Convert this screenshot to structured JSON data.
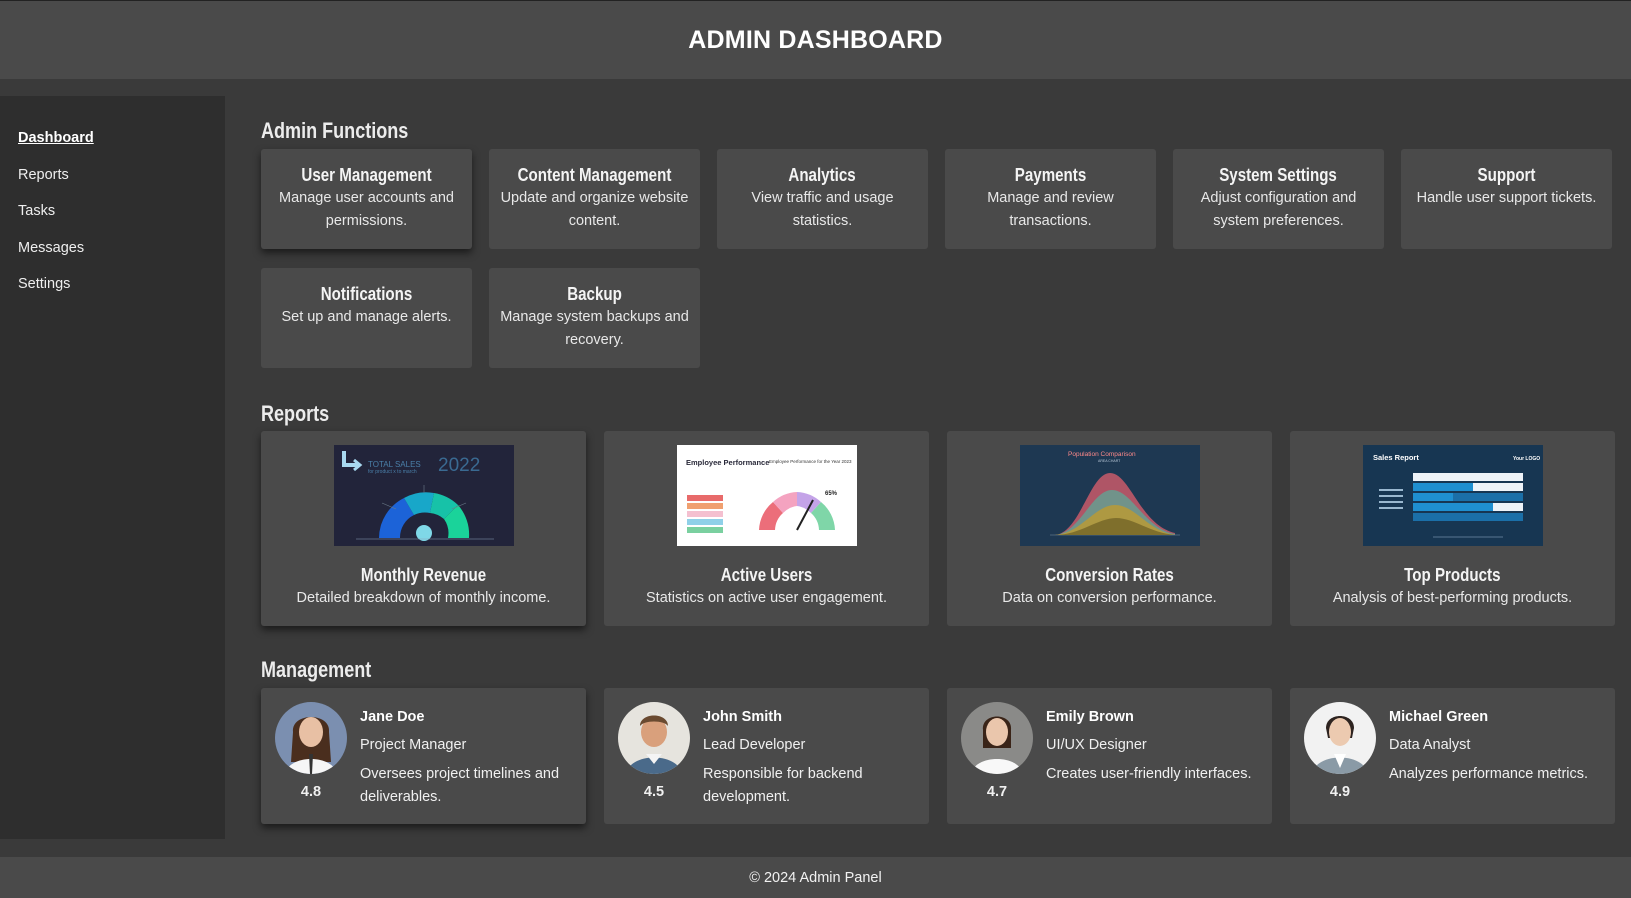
{
  "header": {
    "title": "ADMIN DASHBOARD"
  },
  "sidebar": {
    "items": [
      {
        "label": "Dashboard",
        "active": true
      },
      {
        "label": "Reports"
      },
      {
        "label": "Tasks"
      },
      {
        "label": "Messages"
      },
      {
        "label": "Settings"
      }
    ]
  },
  "admin_functions": {
    "title": "Admin Functions",
    "cards": [
      {
        "title": "User Management",
        "desc": "Manage user accounts and permissions."
      },
      {
        "title": "Content Management",
        "desc": "Update and organize website content."
      },
      {
        "title": "Analytics",
        "desc": "View traffic and usage statistics."
      },
      {
        "title": "Payments",
        "desc": "Manage and review transactions."
      },
      {
        "title": "System Settings",
        "desc": "Adjust configuration and system preferences."
      },
      {
        "title": "Support",
        "desc": "Handle user support tickets."
      },
      {
        "title": "Notifications",
        "desc": "Set up and manage alerts."
      },
      {
        "title": "Backup",
        "desc": "Manage system backups and recovery."
      }
    ]
  },
  "reports": {
    "title": "Reports",
    "cards": [
      {
        "title": "Monthly Revenue",
        "desc": "Detailed breakdown of monthly income.",
        "thumb": {
          "heading": "TOTAL SALES",
          "subheading": "for product x to march",
          "year": "2022"
        }
      },
      {
        "title": "Active Users",
        "desc": "Statistics on active user engagement.",
        "thumb": {
          "heading": "Employee Performance",
          "subheading": "Employee Performance for the Year 2023",
          "percent": "65%"
        }
      },
      {
        "title": "Conversion Rates",
        "desc": "Data on conversion performance.",
        "thumb": {
          "heading": "Population Comparison",
          "subheading": "AREA CHART"
        }
      },
      {
        "title": "Top Products",
        "desc": "Analysis of best-performing products.",
        "thumb": {
          "heading": "Sales Report",
          "logo": "Your LOGO"
        }
      }
    ]
  },
  "management": {
    "title": "Management",
    "people": [
      {
        "name": "Jane Doe",
        "role": "Project Manager",
        "desc": "Oversees project timelines and deliverables.",
        "rating": "4.8"
      },
      {
        "name": "John Smith",
        "role": "Lead Developer",
        "desc": "Responsible for backend development.",
        "rating": "4.5"
      },
      {
        "name": "Emily Brown",
        "role": "UI/UX Designer",
        "desc": "Creates user-friendly interfaces.",
        "rating": "4.7"
      },
      {
        "name": "Michael Green",
        "role": "Data Analyst",
        "desc": "Analyzes performance metrics.",
        "rating": "4.9"
      }
    ]
  },
  "footer": {
    "text": "© 2024 Admin Panel"
  }
}
